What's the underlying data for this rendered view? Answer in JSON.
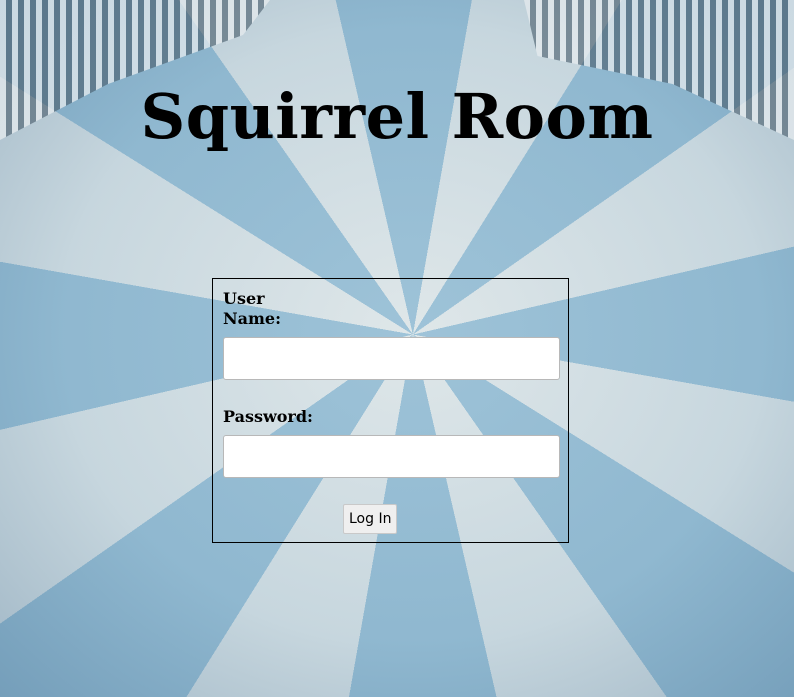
{
  "page": {
    "title": "Squirrel Room"
  },
  "login_form": {
    "username_label": "User Name:",
    "username_value": "",
    "password_label": "Password:",
    "password_value": "",
    "submit_label": "Log In"
  }
}
